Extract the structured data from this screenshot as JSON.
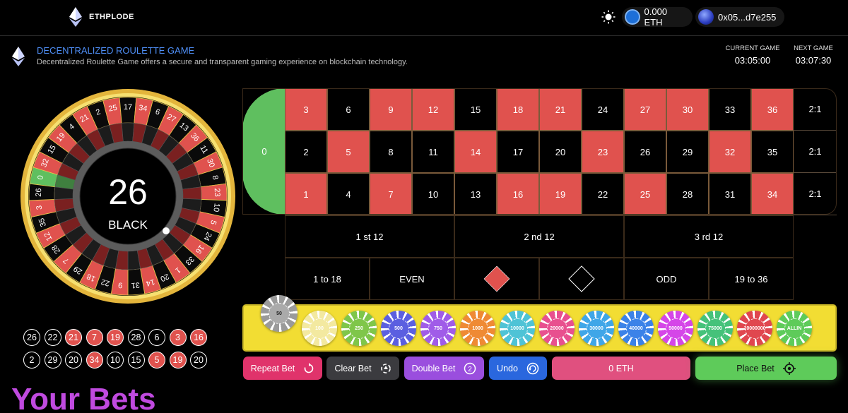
{
  "header": {
    "brand": "ETHPLODE",
    "balance": "0.000 ETH",
    "address": "0x05...d7e255"
  },
  "game": {
    "title": "DECENTRALIZED ROULETTE GAME",
    "description": "Decentralized Roulette Game offers a secure and transparent gaming experience on blockchain technology.",
    "current_label": "CURRENT GAME",
    "current_time": "03:05:00",
    "next_label": "NEXT GAME",
    "next_time": "03:07:30"
  },
  "wheel": {
    "numbers": [
      "0",
      "32",
      "15",
      "19",
      "4",
      "21",
      "2",
      "25",
      "17",
      "34",
      "6",
      "27",
      "13",
      "36",
      "11",
      "30",
      "8",
      "23",
      "10",
      "5",
      "24",
      "16",
      "33",
      "1",
      "20",
      "14",
      "31",
      "9",
      "22",
      "18",
      "29",
      "7",
      "28",
      "12",
      "35",
      "3",
      "26"
    ],
    "result_number": "26",
    "result_color": "BLACK"
  },
  "history": {
    "row1": [
      {
        "n": "26",
        "c": "black"
      },
      {
        "n": "22",
        "c": "black"
      },
      {
        "n": "21",
        "c": "red"
      },
      {
        "n": "7",
        "c": "red"
      },
      {
        "n": "19",
        "c": "red"
      },
      {
        "n": "28",
        "c": "black"
      },
      {
        "n": "6",
        "c": "black"
      },
      {
        "n": "3",
        "c": "red"
      },
      {
        "n": "16",
        "c": "red"
      }
    ],
    "row2": [
      {
        "n": "2",
        "c": "black"
      },
      {
        "n": "29",
        "c": "black"
      },
      {
        "n": "20",
        "c": "black"
      },
      {
        "n": "34",
        "c": "red"
      },
      {
        "n": "10",
        "c": "black"
      },
      {
        "n": "15",
        "c": "black"
      },
      {
        "n": "5",
        "c": "red"
      },
      {
        "n": "19",
        "c": "red"
      },
      {
        "n": "20",
        "c": "black"
      }
    ]
  },
  "board": {
    "zero": "0",
    "top_row": [
      "3",
      "6",
      "9",
      "12",
      "15",
      "18",
      "21",
      "24",
      "27",
      "30",
      "33",
      "36"
    ],
    "mid_row": [
      "2",
      "5",
      "8",
      "11",
      "14",
      "17",
      "20",
      "23",
      "26",
      "29",
      "32",
      "35"
    ],
    "bot_row": [
      "1",
      "4",
      "7",
      "10",
      "13",
      "16",
      "19",
      "22",
      "25",
      "28",
      "31",
      "34"
    ],
    "red_numbers": [
      "1",
      "3",
      "5",
      "7",
      "9",
      "12",
      "14",
      "16",
      "18",
      "19",
      "21",
      "23",
      "25",
      "27",
      "30",
      "32",
      "34",
      "36"
    ],
    "column_bet": "2:1",
    "dozens": [
      "1 st 12",
      "2 nd 12",
      "3 rd 12"
    ],
    "low": "1 to 18",
    "even": "EVEN",
    "odd": "ODD",
    "high": "19 to 36"
  },
  "chips": [
    {
      "label": "50",
      "color": "#9a9a9a",
      "selected": true
    },
    {
      "label": "100",
      "color": "#f3e9a0"
    },
    {
      "label": "250",
      "color": "#7fc64a"
    },
    {
      "label": "500",
      "color": "#5b5fe0"
    },
    {
      "label": "750",
      "color": "#a05ce8"
    },
    {
      "label": "1000",
      "color": "#ef8a34"
    },
    {
      "label": "10000",
      "color": "#4fc3d6"
    },
    {
      "label": "20000",
      "color": "#e8508f"
    },
    {
      "label": "30000",
      "color": "#3fa6e8"
    },
    {
      "label": "40000",
      "color": "#3b82e8"
    },
    {
      "label": "50000",
      "color": "#d546e8"
    },
    {
      "label": "75000",
      "color": "#45c27a"
    },
    {
      "label": "10000000",
      "color": "#e0474f"
    },
    {
      "label": "ALLIN",
      "color": "#5ecb5a"
    }
  ],
  "actions": {
    "repeat": "Repeat Bet",
    "clear": "Clear Bet",
    "double": "Double Bet",
    "undo": "Undo",
    "amount": "0 ETH",
    "place": "Place Bet"
  },
  "bets_title": "Your Bets",
  "colors": {
    "red": "#e0524e",
    "green": "#5fbf5f",
    "accent": "#4f8ff7",
    "tray": "#f2dd33",
    "bets_title": "#c04adf"
  }
}
